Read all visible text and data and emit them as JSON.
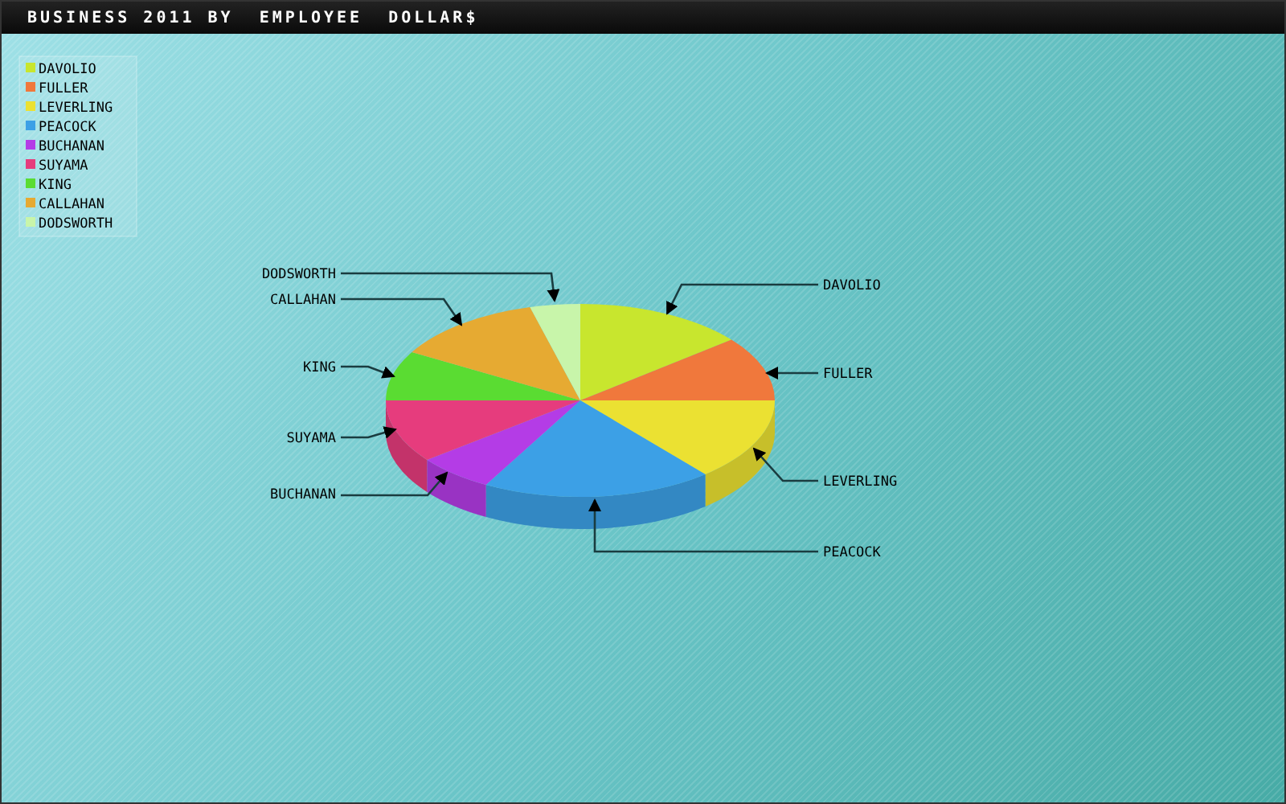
{
  "title": "BUSINESS 2011 BY  EMPLOYEE  DOLLAR$",
  "legend": [
    {
      "label": "DAVOLIO",
      "color": "#c8e62e"
    },
    {
      "label": "FULLER",
      "color": "#f0783c"
    },
    {
      "label": "LEVERLING",
      "color": "#ebe132"
    },
    {
      "label": "PEACOCK",
      "color": "#3ca0e6"
    },
    {
      "label": "BUCHANAN",
      "color": "#b43ce6"
    },
    {
      "label": "SUYAMA",
      "color": "#e63c7d"
    },
    {
      "label": "KING",
      "color": "#5adc32"
    },
    {
      "label": "CALLAHAN",
      "color": "#e6aa32"
    },
    {
      "label": "DODSWORTH",
      "color": "#c8f5aa"
    }
  ],
  "callouts": [
    {
      "label": "DODSWORTH"
    },
    {
      "label": "DAVOLIO"
    },
    {
      "label": "CALLAHAN"
    },
    {
      "label": "KING"
    },
    {
      "label": "FULLER"
    },
    {
      "label": "SUYAMA"
    },
    {
      "label": "LEVERLING"
    },
    {
      "label": "BUCHANAN"
    },
    {
      "label": "PEACOCK"
    }
  ]
}
